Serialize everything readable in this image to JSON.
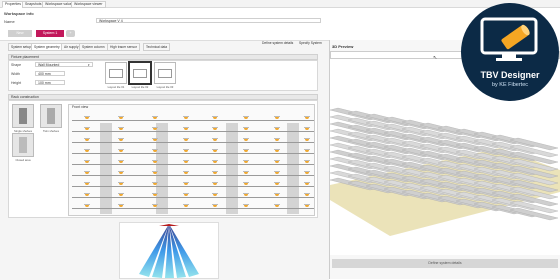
{
  "app": {
    "tabs": [
      "Properties",
      "Snapshots",
      "Workspace values",
      "Workspace viewer"
    ]
  },
  "header": {
    "title": "Workspace info",
    "name_label": "Name",
    "name_value": "Workspace V 4"
  },
  "toolbar": {
    "new_label": "New",
    "system_label": "System 1",
    "add_label": "+"
  },
  "subtabs": [
    "System setup",
    "System geometry",
    "Air supply",
    "System column",
    "High tracer sensor",
    "Technical data"
  ],
  "right_buttons": {
    "system_details": "Define system details",
    "system_options": "Specify System"
  },
  "fixture": {
    "section_title": "Fixture placement",
    "shape_label": "Shape",
    "shape_value": "Wall Mounted",
    "width_label": "Width",
    "width_value": "400 mm",
    "height_label": "Height",
    "height_value": "100 mm",
    "thumbs": [
      "Layout tile 01",
      "Layout tile 02",
      "Layout tile 03"
    ]
  },
  "rack": {
    "section_title": "Rack construction",
    "view_title": "Front view",
    "options": [
      "Single shelves",
      "Twin shelves",
      "Closed area"
    ]
  },
  "preview": {
    "title": "3D Preview",
    "define_button": "Define system details"
  },
  "logo": {
    "title": "TBV Designer",
    "subtitle": "by KE Fibertec"
  },
  "colors": {
    "accent": "#c2185b",
    "logo_bg": "#0c2a46",
    "light": "#f0a830"
  }
}
